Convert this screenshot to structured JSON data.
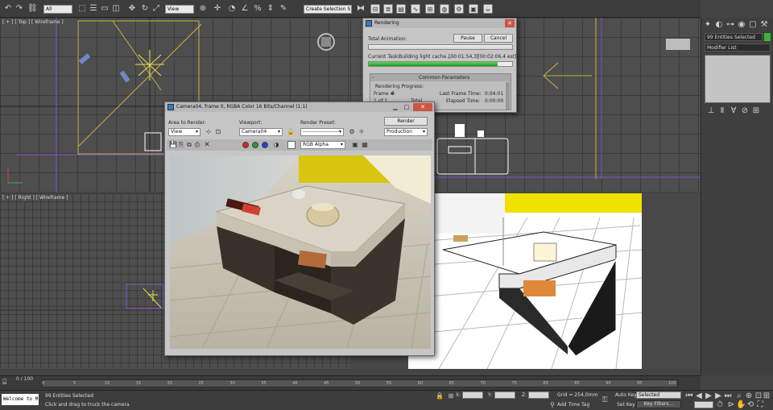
{
  "toolbar": {
    "filter_value": "All",
    "view_value": "View",
    "selection_set_placeholder": "Create Selection S"
  },
  "viewports": {
    "top_label": "[ + ] [ Top ] [ Wireframe ]",
    "right_label": "[ + ] [ Right ] [ Wireframe ]"
  },
  "command_panel": {
    "selection_count": "99 Entities Selected",
    "modifier_list": "Modifier List"
  },
  "rendering_dialog": {
    "title": "Rendering",
    "total_animation_label": "Total Animation:",
    "pause_label": "Pause",
    "cancel_label": "Cancel",
    "current_task_label": "Current Task:",
    "current_task_value": "Building light cache...",
    "current_task_time": "[00:01:54,3]",
    "current_task_est": "[00:02:06,4 est]",
    "total_progress": 1.0,
    "task_progress": 0.9,
    "section_title": "Common Parameters",
    "rendering_progress_label": "Rendering Progress:",
    "frame_label": "Frame #",
    "frame_value": "0",
    "of_label": "1 of 1",
    "total_label": "Total",
    "last_frame_time_label": "Last Frame Time:",
    "last_frame_time_value": "0:04:01",
    "elapsed_time_label": "Elapsed Time:",
    "elapsed_time_value": "0:00:00"
  },
  "frame_window": {
    "title": "Camera04, frame 0, RGBA Color 16 Bits/Channel (1:1)",
    "area_to_render_label": "Area to Render:",
    "area_to_render_value": "View",
    "viewport_label": "Viewport:",
    "viewport_value": "Camera04",
    "render_preset_label": "Render Preset:",
    "render_preset_value": "---------------------",
    "render_button": "Render",
    "production_value": "Production",
    "channel_value": "RGB Alpha",
    "channel_colors": [
      "#e02020",
      "#20a020",
      "#2040e0"
    ]
  },
  "timeline": {
    "frame_counter": "0 / 100",
    "ticks": [
      "0",
      "5",
      "10",
      "15",
      "20",
      "25",
      "30",
      "35",
      "40",
      "45",
      "50",
      "55",
      "60",
      "65",
      "70",
      "75",
      "80",
      "85",
      "90",
      "95",
      "100"
    ]
  },
  "statusbar": {
    "maxscript_text": "Welcome to M",
    "selection_text": "99 Entities Selected",
    "prompt_text": "Click and drag to truck the camera",
    "x_label": "X:",
    "y_label": "Y:",
    "z_label": "Z:",
    "grid_text": "Grid = 254,0mm",
    "add_time_tag": "Add Time Tag",
    "auto_key": "Auto Key",
    "set_key": "Set Key",
    "selected_value": "Selected",
    "key_filters": "Key Filters..."
  }
}
